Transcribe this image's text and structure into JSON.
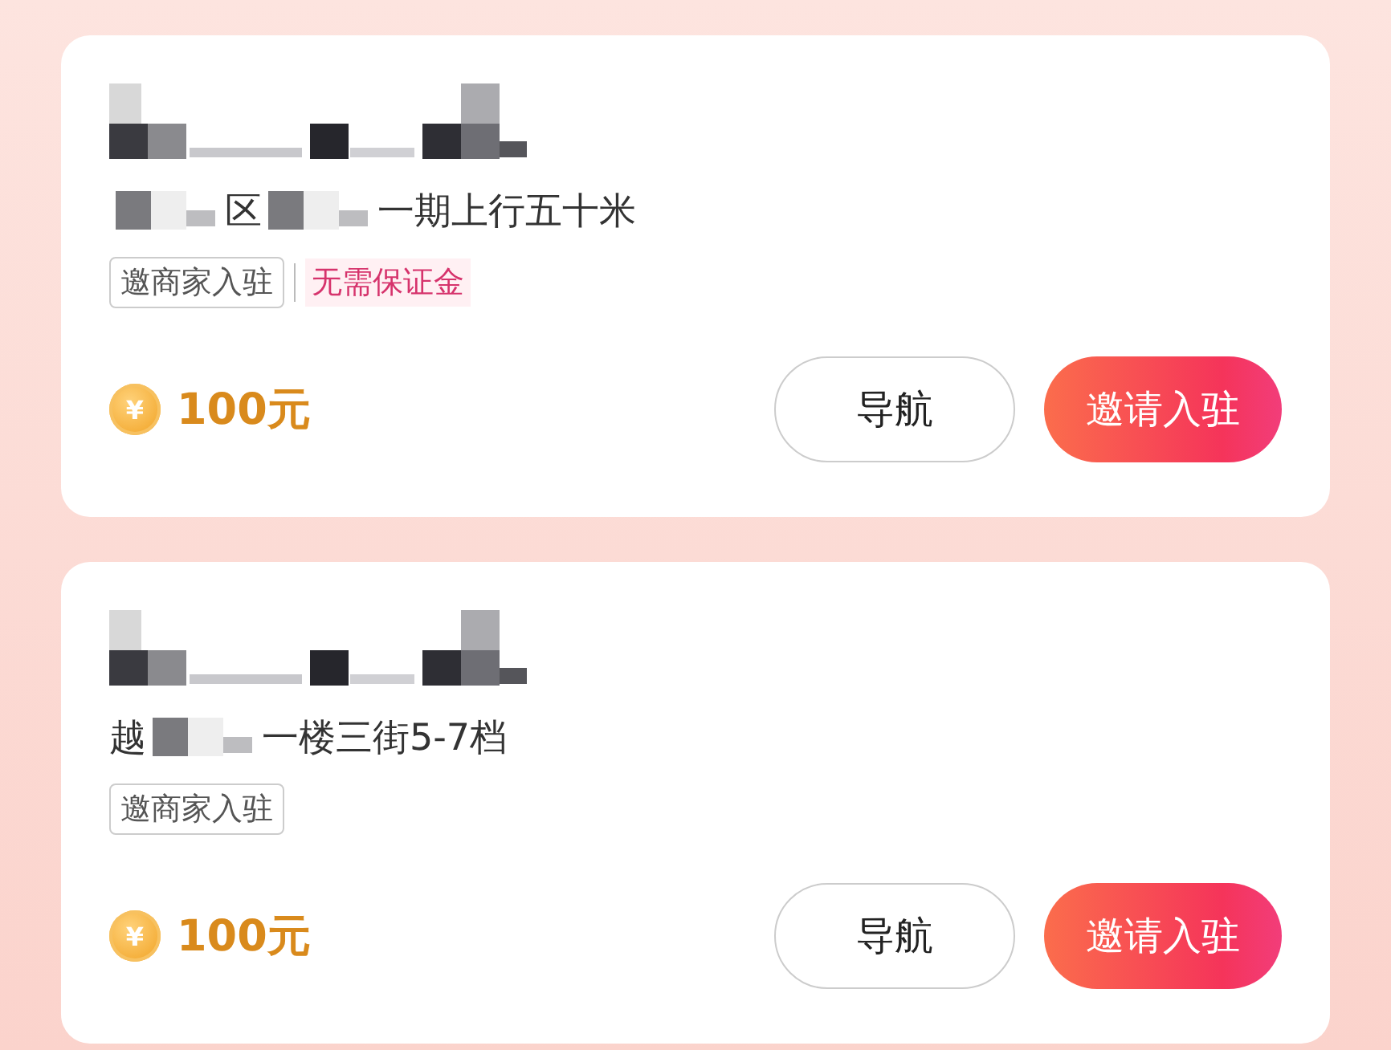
{
  "cards": [
    {
      "title": {
        "kind": "redacted"
      },
      "address": [
        {
          "kind": "redacted"
        },
        {
          "kind": "text",
          "text": "区"
        },
        {
          "kind": "redacted"
        },
        {
          "kind": "text",
          "text": "一期上行五十米"
        }
      ],
      "tags": [
        {
          "kind": "outline",
          "text": "邀商家入驻"
        },
        {
          "kind": "highlight",
          "text": "无需保证金"
        }
      ],
      "coin_symbol": "¥",
      "reward": "100元",
      "buttons": [
        {
          "kind": "outline",
          "label": "导航"
        },
        {
          "kind": "primary",
          "label": "邀请入驻"
        }
      ]
    },
    {
      "title": {
        "kind": "redacted"
      },
      "address": [
        {
          "kind": "text",
          "text": "越"
        },
        {
          "kind": "redacted"
        },
        {
          "kind": "text",
          "text": "一楼三街5-7档"
        }
      ],
      "tags": [
        {
          "kind": "outline",
          "text": "邀商家入驻"
        }
      ],
      "coin_symbol": "¥",
      "reward": "100元",
      "buttons": [
        {
          "kind": "outline",
          "label": "导航"
        },
        {
          "kind": "primary",
          "label": "邀请入驻"
        }
      ]
    }
  ]
}
